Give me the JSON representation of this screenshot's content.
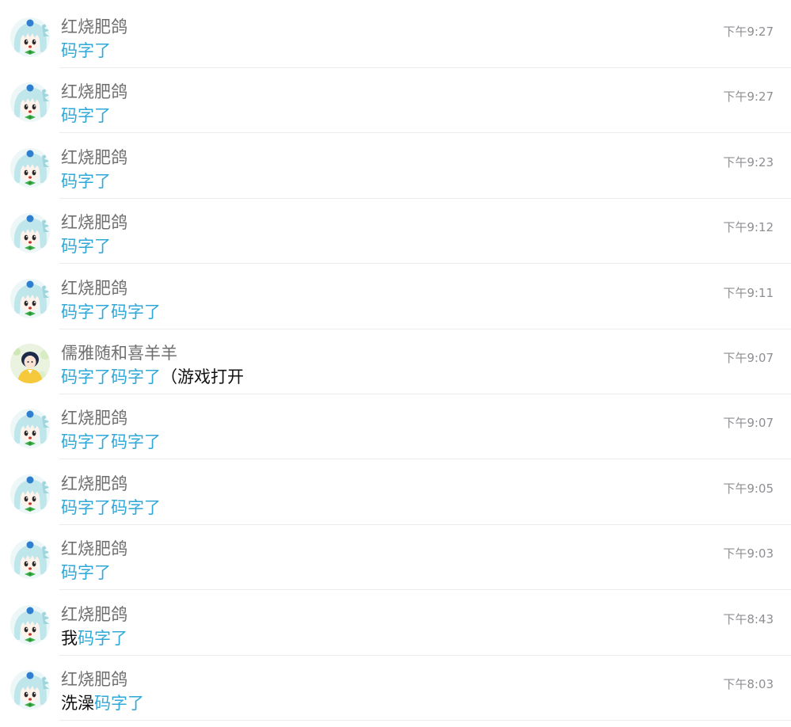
{
  "messages": [
    {
      "avatar": "anime-girl-blue-hair-avatar",
      "sender": "红烧肥鸽",
      "parts": [
        {
          "text": "码字了",
          "highlight": true
        }
      ],
      "time": "下午9:27"
    },
    {
      "avatar": "anime-girl-blue-hair-avatar",
      "sender": "红烧肥鸽",
      "parts": [
        {
          "text": "码字了",
          "highlight": true
        }
      ],
      "time": "下午9:27"
    },
    {
      "avatar": "anime-girl-blue-hair-avatar",
      "sender": "红烧肥鸽",
      "parts": [
        {
          "text": "码字了",
          "highlight": true
        }
      ],
      "time": "下午9:23"
    },
    {
      "avatar": "anime-girl-blue-hair-avatar",
      "sender": "红烧肥鸽",
      "parts": [
        {
          "text": "码字了",
          "highlight": true
        }
      ],
      "time": "下午9:12"
    },
    {
      "avatar": "anime-girl-blue-hair-avatar",
      "sender": "红烧肥鸽",
      "parts": [
        {
          "text": "码字了码字了",
          "highlight": true
        }
      ],
      "time": "下午9:11"
    },
    {
      "avatar": "girl-yellow-coat-avatar",
      "sender": "儒雅随和喜羊羊",
      "parts": [
        {
          "text": "码字了码字了",
          "highlight": true
        },
        {
          "text": "（游戏打开",
          "highlight": false
        }
      ],
      "time": "下午9:07"
    },
    {
      "avatar": "anime-girl-blue-hair-avatar",
      "sender": "红烧肥鸽",
      "parts": [
        {
          "text": "码字了码字了",
          "highlight": true
        }
      ],
      "time": "下午9:07"
    },
    {
      "avatar": "anime-girl-blue-hair-avatar",
      "sender": "红烧肥鸽",
      "parts": [
        {
          "text": "码字了码字了",
          "highlight": true
        }
      ],
      "time": "下午9:05"
    },
    {
      "avatar": "anime-girl-blue-hair-avatar",
      "sender": "红烧肥鸽",
      "parts": [
        {
          "text": "码字了",
          "highlight": true
        }
      ],
      "time": "下午9:03"
    },
    {
      "avatar": "anime-girl-blue-hair-avatar",
      "sender": "红烧肥鸽",
      "parts": [
        {
          "text": "我",
          "highlight": false
        },
        {
          "text": "码字了",
          "highlight": true
        }
      ],
      "time": "下午8:43"
    },
    {
      "avatar": "anime-girl-blue-hair-avatar",
      "sender": "红烧肥鸽",
      "parts": [
        {
          "text": "洗澡",
          "highlight": false
        },
        {
          "text": "码字了",
          "highlight": true
        }
      ],
      "time": "下午8:03"
    }
  ],
  "colors": {
    "highlight": "#2fa8d8",
    "text": "#111111",
    "sender": "#6f6f6f",
    "time": "#8e8e93",
    "divider": "#ececec"
  }
}
